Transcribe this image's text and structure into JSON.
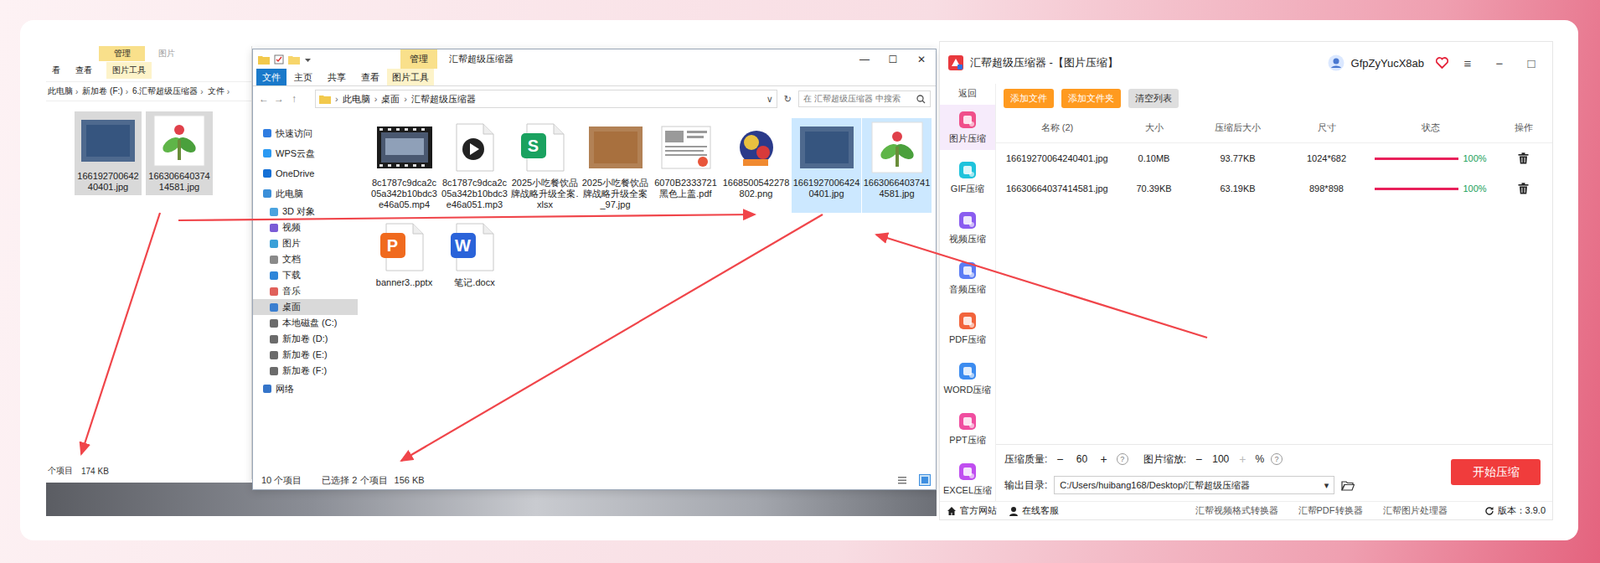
{
  "left_window": {
    "ribbon_top": [
      {
        "label": "管理",
        "kind": "context"
      },
      {
        "label": "图片",
        "kind": "title"
      }
    ],
    "ribbon_tabs": [
      {
        "label": "看",
        "kind": "tab"
      },
      {
        "label": "查看",
        "kind": "tab"
      },
      {
        "label": "图片工具",
        "kind": "context"
      }
    ],
    "breadcrumb": [
      "此电脑",
      "新加卷 (F:)",
      "6.汇帮超级压缩器",
      "文件"
    ],
    "separator": "›",
    "files": [
      {
        "name": "16619270064240401.jpg",
        "kind": "photo",
        "color": "#36557f",
        "selected": true
      },
      {
        "name": "16630664037414581.jpg",
        "kind": "logo",
        "selected": true
      }
    ],
    "status": [
      "个项目",
      "174 KB"
    ]
  },
  "middle_window": {
    "title": "汇帮超级压缩器",
    "context_tab": "管理",
    "controls": [
      "—",
      "☐",
      "✕"
    ],
    "ribbon_tabs": [
      {
        "label": "文件",
        "kind": "file"
      },
      {
        "label": "主页",
        "kind": "tab"
      },
      {
        "label": "共享",
        "kind": "tab"
      },
      {
        "label": "查看",
        "kind": "tab"
      },
      {
        "label": "图片工具",
        "kind": "context"
      }
    ],
    "nav_buttons": [
      "←",
      "→",
      "↑"
    ],
    "breadcrumb": [
      "此电脑",
      "桌面",
      "汇帮超级压缩器"
    ],
    "separator": "›",
    "address_buttons": [
      "∨",
      "↻"
    ],
    "search": {
      "placeholder": "在 汇帮超级压缩器 中搜索"
    },
    "nav": [
      {
        "label": "快速访问",
        "kind": "root",
        "selected": false
      },
      {
        "label": "WPS云盘",
        "kind": "root",
        "selected": false
      },
      {
        "label": "OneDrive",
        "kind": "root",
        "selected": false
      },
      {
        "label": "此电脑",
        "kind": "root",
        "selected": false
      },
      {
        "label": "3D 对象",
        "kind": "child",
        "selected": false
      },
      {
        "label": "视频",
        "kind": "child",
        "selected": false
      },
      {
        "label": "图片",
        "kind": "child",
        "selected": false
      },
      {
        "label": "文档",
        "kind": "child",
        "selected": false
      },
      {
        "label": "下载",
        "kind": "child",
        "selected": false
      },
      {
        "label": "音乐",
        "kind": "child",
        "selected": false
      },
      {
        "label": "桌面",
        "kind": "child",
        "selected": true
      },
      {
        "label": "本地磁盘 (C:)",
        "kind": "child",
        "selected": false
      },
      {
        "label": "新加卷 (D:)",
        "kind": "child",
        "selected": false
      },
      {
        "label": "新加卷 (E:)",
        "kind": "child",
        "selected": false
      },
      {
        "label": "新加卷 (F:)",
        "kind": "child",
        "selected": false
      },
      {
        "label": "网络",
        "kind": "root",
        "selected": false
      }
    ],
    "files": [
      {
        "name": "8c1787c9dca2c05a342b10bdc3e46a05.mp4",
        "kind": "video",
        "color": "#4a5870",
        "selected": false
      },
      {
        "name": "8c1787c9dca2c05a342b10bdc3e46a051.mp3",
        "kind": "audio",
        "selected": false
      },
      {
        "name": "2025小吃餐饮品牌战略升级全案.xlsx",
        "kind": "sheet",
        "badge": "S",
        "selected": false
      },
      {
        "name": "2025小吃餐饮品牌战略升级全案_97.jpg",
        "kind": "photo",
        "color": "#a8703e",
        "selected": false
      },
      {
        "name": "6070B2333721黑色上盖.pdf",
        "kind": "scan",
        "selected": false
      },
      {
        "name": "1668500542278802.png",
        "kind": "art",
        "selected": false
      },
      {
        "name": "16619270064240401.jpg",
        "kind": "photo",
        "color": "#36557f",
        "selected": true
      },
      {
        "name": "16630664037414581.jpg",
        "kind": "logo",
        "selected": true
      },
      {
        "name": "banner3..pptx",
        "kind": "slides",
        "badge": "P",
        "selected": false
      },
      {
        "name": "笔记.docx",
        "kind": "word",
        "badge": "W",
        "selected": false
      }
    ],
    "status": {
      "count": "10 个项目",
      "selection": "已选择 2 个项目",
      "size": "156 KB"
    }
  },
  "app": {
    "title": "汇帮超级压缩器 -【图片压缩】",
    "user": "GfpZyYucX8ab",
    "controls": [
      "≡",
      "−",
      "□"
    ],
    "back": "返回",
    "sidebar": [
      {
        "label": "图片压缩",
        "selected": true,
        "color": "#f0508a"
      },
      {
        "label": "GIF压缩",
        "selected": false,
        "color": "#1fc3dc"
      },
      {
        "label": "视频压缩",
        "selected": false,
        "color": "#8a5cf0"
      },
      {
        "label": "音频压缩",
        "selected": false,
        "color": "#5b7cf5"
      },
      {
        "label": "PDF压缩",
        "selected": false,
        "color": "#f2643c"
      },
      {
        "label": "WORD压缩",
        "selected": false,
        "color": "#3c8cf0"
      },
      {
        "label": "PPT压缩",
        "selected": false,
        "color": "#f04ea0"
      },
      {
        "label": "EXCEL压缩",
        "selected": false,
        "color": "#c04ef0"
      }
    ],
    "toolbar": [
      {
        "label": "添加文件",
        "kind": "primary"
      },
      {
        "label": "添加文件夹",
        "kind": "primary"
      },
      {
        "label": "清空列表",
        "kind": "secondary"
      }
    ],
    "table": {
      "columns": [
        "名称 (2)",
        "大小",
        "压缩后大小",
        "尺寸",
        "状态",
        "操作"
      ],
      "rows": [
        {
          "name": "16619270064240401.jpg",
          "size": "0.10MB",
          "compressed": "93.77KB",
          "dimensions": "1024*682",
          "level": 1,
          "reading": "100%"
        },
        {
          "name": "16630664037414581.jpg",
          "size": "70.39KB",
          "compressed": "63.19KB",
          "dimensions": "898*898",
          "level": 1,
          "reading": "100%"
        }
      ]
    },
    "quality": {
      "label": "压缩质量:",
      "minus": "−",
      "value": "60",
      "plus": "+",
      "plus_disabled": false,
      "help": "?"
    },
    "scale": {
      "label": "图片缩放:",
      "minus": "−",
      "value": "100",
      "plus": "+",
      "plus_disabled": true,
      "unit": "%",
      "help": "?"
    },
    "output": {
      "label": "输出目录:",
      "path": "C:/Users/huibang168/Desktop/汇帮超级压缩器",
      "caret": "▾"
    },
    "start": "开始压缩",
    "footer": {
      "left": [
        "官方网站",
        "在线客服"
      ],
      "links": [
        "汇帮视频格式转换器",
        "汇帮PDF转换器",
        "汇帮图片处理器"
      ],
      "version": "版本：3.9.0"
    }
  }
}
